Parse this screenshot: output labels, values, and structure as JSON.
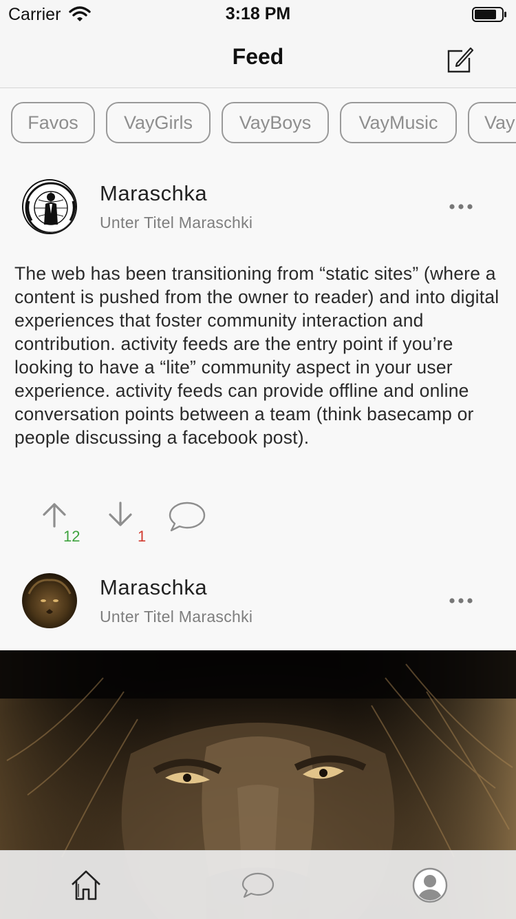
{
  "status_bar": {
    "carrier": "Carrier",
    "time": "3:18 PM"
  },
  "nav": {
    "title": "Feed",
    "compose_icon": "compose-icon"
  },
  "categories": [
    "Favos",
    "VayGirls",
    "VayBoys",
    "VayMusic",
    "Vay"
  ],
  "posts": [
    {
      "author": "Maraschka",
      "subtitle": "Unter Titel Maraschki",
      "avatar": "anonymous-emblem",
      "body": "The web has been transitioning from “static sites” (where a content is pushed from the owner to reader) and into digital experiences that foster community interaction and contribution. activity feeds are the entry point if you’re looking to have a “lite” community aspect in your user experience. activity feeds can provide offline and online conversation points between a team (think basecamp or people discussing a facebook post).",
      "upvotes": "12",
      "downvotes": "1"
    },
    {
      "author": "Maraschka",
      "subtitle": "Unter Titel Maraschki",
      "avatar": "lion-photo",
      "image": "lion-face-photo"
    }
  ],
  "tabs": [
    {
      "name": "home",
      "icon": "home-icon",
      "active": true
    },
    {
      "name": "messages",
      "icon": "chat-bubble-icon",
      "active": false
    },
    {
      "name": "profile",
      "icon": "profile-avatar-icon",
      "active": false
    }
  ],
  "colors": {
    "upvote": "#3fa33f",
    "downvote": "#d23b30",
    "chip_border": "#999999",
    "icon_gray": "#8e8e8e"
  }
}
